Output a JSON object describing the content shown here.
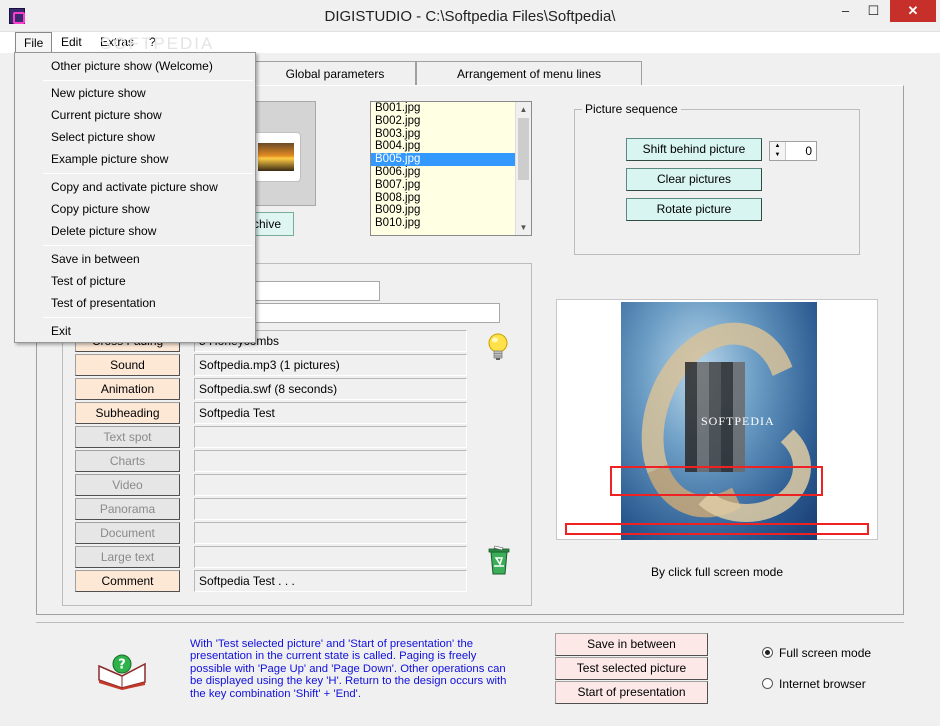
{
  "window": {
    "title": "DIGISTUDIO - C:\\Softpedia Files\\Softpedia\\",
    "minimize_glyph": "–",
    "maximize_glyph": "☐",
    "close_glyph": "✕"
  },
  "menubar": {
    "items": [
      {
        "label": "File"
      },
      {
        "label": "Edit"
      },
      {
        "label": "Extras"
      },
      {
        "label": "?"
      }
    ],
    "watermark": "SOFTPEDIA"
  },
  "file_menu": {
    "items": [
      {
        "label": "Other picture show (Welcome)"
      },
      {
        "label": "New picture show"
      },
      {
        "label": "Current picture show"
      },
      {
        "label": "Select picture show"
      },
      {
        "label": "Example picture show"
      },
      {
        "label": "Copy and activate picture show"
      },
      {
        "label": "Copy picture show"
      },
      {
        "label": "Delete picture show"
      },
      {
        "label": "Save in between"
      },
      {
        "label": "Test of picture"
      },
      {
        "label": "Test of presentation"
      },
      {
        "label": "Exit"
      }
    ]
  },
  "tabs": [
    {
      "label": "Global parameters"
    },
    {
      "label": "Arrangement of menu lines"
    }
  ],
  "archive_button": {
    "label": "chive"
  },
  "file_list": {
    "items": [
      "B001.jpg",
      "B002.jpg",
      "B003.jpg",
      "B004.jpg",
      "B005.jpg",
      "B006.jpg",
      "B007.jpg",
      "B008.jpg",
      "B009.jpg",
      "B010.jpg"
    ],
    "selected": "B005.jpg"
  },
  "picture_sequence": {
    "legend": "Picture sequence",
    "shift_label": "Shift behind picture",
    "clear_label": "Clear pictures",
    "rotate_label": "Rotate picture",
    "spinner_value": "0"
  },
  "fields": {
    "partial_button": "Cross Fading",
    "partial_value": "5 Honeycombs",
    "rows": [
      {
        "label": "Sound",
        "value": "Softpedia.mp3   (1 pictures)",
        "active": true
      },
      {
        "label": "Animation",
        "value": "Softpedia.swf   (8 seconds)",
        "active": true
      },
      {
        "label": "Subheading",
        "value": "Softpedia Test",
        "active": true
      },
      {
        "label": "Text spot",
        "value": "",
        "active": false
      },
      {
        "label": "Charts",
        "value": "",
        "active": false
      },
      {
        "label": "Video",
        "value": "",
        "active": false
      },
      {
        "label": "Panorama",
        "value": "",
        "active": false
      },
      {
        "label": "Document",
        "value": "",
        "active": false
      },
      {
        "label": "Large text",
        "value": "",
        "active": false
      },
      {
        "label": "Comment",
        "value": "Softpedia Test . . .",
        "active": true
      }
    ]
  },
  "preview": {
    "watermark": "SOFTPEDIA",
    "caption": "By click full screen mode"
  },
  "info_text": "With 'Test selected picture' and 'Start of presentation' the presentation in the current state is called. Paging is freely possible with 'Page Up' and 'Page Down'. Other operations can be displayed using the key 'H'. Return to the design occurs with the key combination 'Shift' + 'End'.",
  "actions": {
    "save_label": "Save in between",
    "test_label": "Test selected picture",
    "start_label": "Start of presentation"
  },
  "display_mode": {
    "options": [
      {
        "label": "Full screen mode",
        "checked": true
      },
      {
        "label": "Internet browser",
        "checked": false
      }
    ]
  },
  "colors": {
    "selection": "#3399ff",
    "info_text": "#1010dd",
    "close_button": "#c7302a",
    "highlight_box": "#ee2222"
  }
}
